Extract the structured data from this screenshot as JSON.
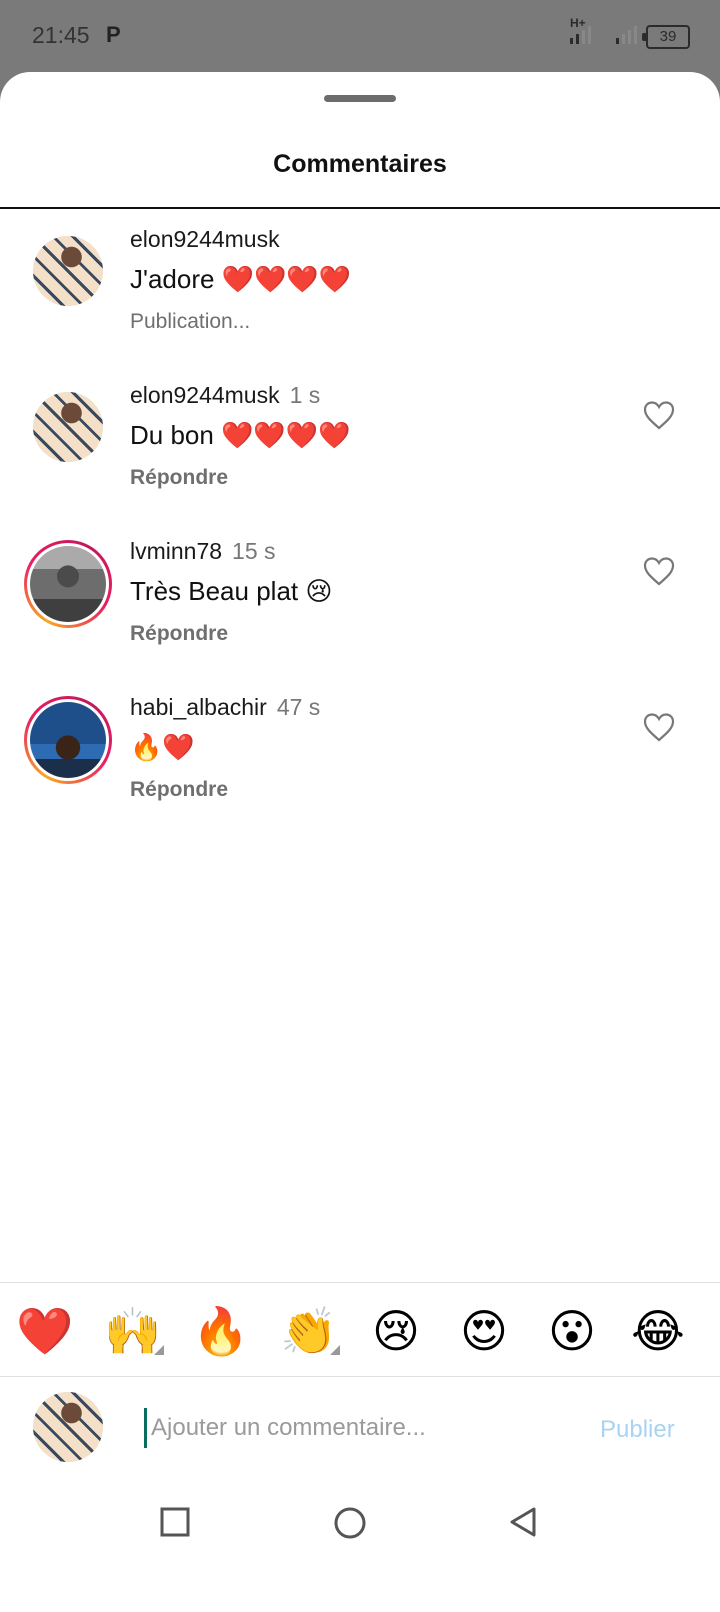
{
  "status_bar": {
    "time": "21:45",
    "notification_icon": "p-icon",
    "network_type": "H+",
    "battery_level": "39"
  },
  "sheet": {
    "title": "Commentaires"
  },
  "comments": [
    {
      "username": "elon9244musk",
      "time": "",
      "text": "J'adore ❤️❤️❤️❤️",
      "status": "Publication...",
      "avatar": "avatar-elon",
      "liked": false
    },
    {
      "username": "elon9244musk",
      "time": "1 s",
      "text": "Du bon ❤️❤️❤️❤️",
      "reply_label": "Répondre",
      "avatar": "avatar-elon",
      "liked": false
    },
    {
      "username": "lvminn78",
      "time": "15 s",
      "text": "Très Beau plat 😢",
      "reply_label": "Répondre",
      "avatar": "avatar-lvminn",
      "liked": false
    },
    {
      "username": "habi_albachir",
      "time": "47 s",
      "text": "🔥❤️",
      "reply_label": "Répondre",
      "avatar": "avatar-habi",
      "liked": false
    }
  ],
  "reactions": [
    "❤️",
    "🙌",
    "🔥",
    "👏",
    "😢",
    "😍",
    "😮",
    "😂"
  ],
  "composer": {
    "placeholder": "Ajouter un commentaire...",
    "publish_label": "Publier",
    "publish_color": "#a9d3f2"
  },
  "navigation": {
    "recents": "square-icon",
    "home": "circle-icon",
    "back": "triangle-back-icon"
  }
}
